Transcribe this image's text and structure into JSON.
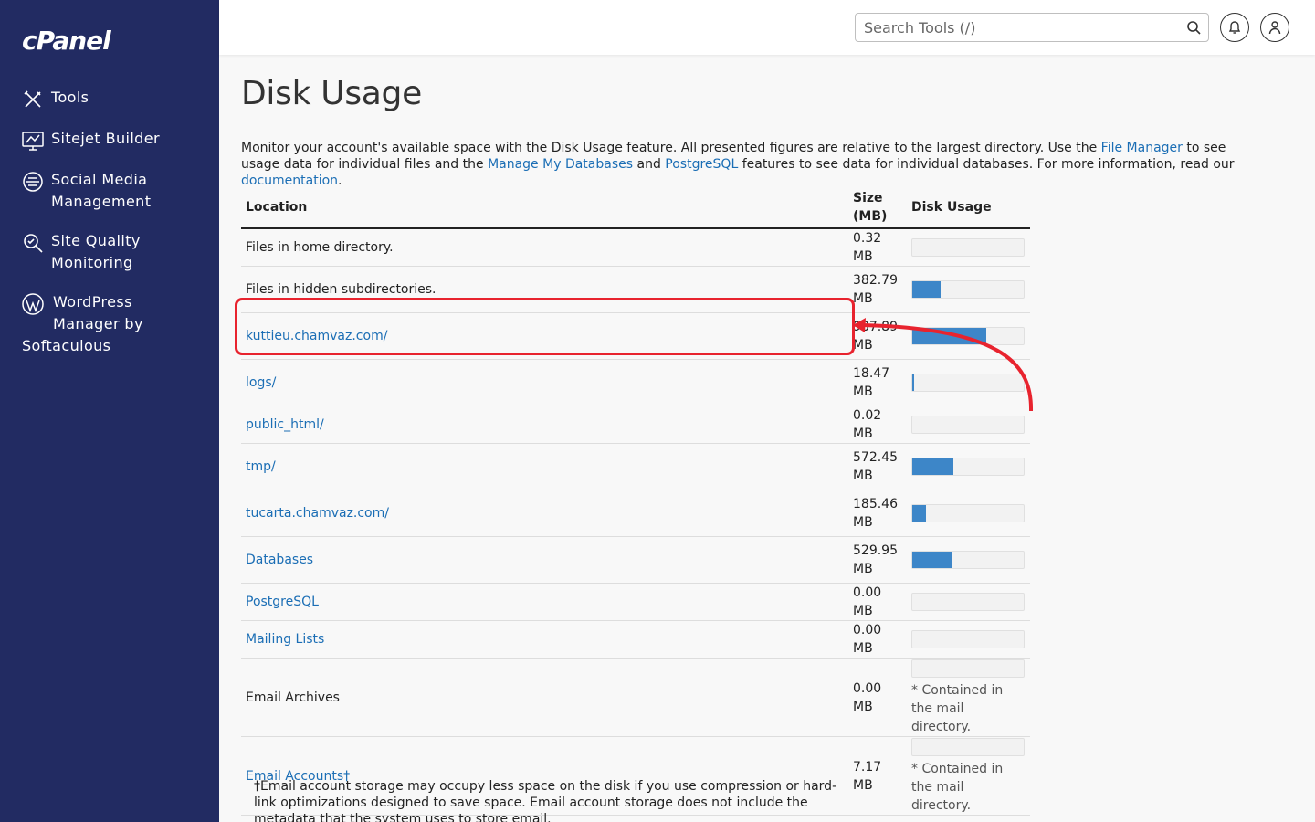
{
  "app": {
    "logo": "cPanel",
    "brand_color": "#222b62",
    "accent_color": "#1b6eb5"
  },
  "sidebar": {
    "items": [
      {
        "label": "Tools",
        "icon": "tools-icon"
      },
      {
        "label": "Sitejet Builder",
        "icon": "sitejet-icon"
      },
      {
        "label": "Social Media Management",
        "icon": "social-media-icon"
      },
      {
        "label": "Site Quality Monitoring",
        "icon": "site-quality-icon"
      },
      {
        "label_line1": "WordPress",
        "label_line2": "Manager by",
        "label_line3": "Softaculous",
        "icon": "wordpress-icon"
      }
    ]
  },
  "header": {
    "search_placeholder": "Search Tools (/)",
    "search_icon": "search-icon",
    "notifications_icon": "bell-icon",
    "user_icon": "user-icon"
  },
  "page": {
    "title": "Disk Usage",
    "intro": {
      "part1": "Monitor your account's available space with the Disk Usage feature. All presented figures are relative to the largest directory. Use the ",
      "link1": "File Manager",
      "part2": " to see usage data for individual files and the ",
      "link2": "Manage My Databases",
      "part3": " and ",
      "link3": "PostgreSQL",
      "part4": " features to see data for individual databases. For more information, read our ",
      "link4": "documentation",
      "part5": "."
    }
  },
  "table": {
    "headers": {
      "location": "Location",
      "size": "Size (MB)",
      "usage": "Disk Usage"
    },
    "rows": [
      {
        "location": "Files in home directory.",
        "size": "0.32 MB",
        "fraction": 0.0,
        "link": false
      },
      {
        "location": "Files in hidden subdirectories.",
        "size": "382.79 MB",
        "fraction": 0.25,
        "link": false
      },
      {
        "location": "kuttieu.chamvaz.com/",
        "size": "987.89 MB",
        "fraction": 0.66,
        "link": true
      },
      {
        "location": "logs/",
        "size": "18.47 MB",
        "fraction": 0.02,
        "link": true
      },
      {
        "location": "public_html/",
        "size": "0.02 MB",
        "fraction": 0.0,
        "link": true
      },
      {
        "location": "tmp/",
        "size": "572.45 MB",
        "fraction": 0.37,
        "link": true
      },
      {
        "location": "tucarta.chamvaz.com/",
        "size": "185.46 MB",
        "fraction": 0.12,
        "link": true
      },
      {
        "location": "Databases",
        "size": "529.95 MB",
        "fraction": 0.35,
        "link": true
      },
      {
        "location": "PostgreSQL",
        "size": "0.00 MB",
        "fraction": 0.0,
        "link": true
      },
      {
        "location": "Mailing Lists",
        "size": "0.00 MB",
        "fraction": 0.0,
        "link": true
      },
      {
        "location": "Email Archives",
        "size": "0.00 MB",
        "fraction": 0.0,
        "link": false,
        "note": "* Contained in the mail directory."
      },
      {
        "location": "Email Accounts†",
        "size": "7.17 MB",
        "fraction": 0.0,
        "link": true,
        "note": "* Contained in the mail directory."
      }
    ],
    "footnote": "†Email account storage may occupy less space on the disk if you use compression or hard-link optimizations designed to save space. Email account storage does not include the metadata that the system uses to store email."
  },
  "annotation": {
    "highlight_color": "#e8232e",
    "highlighted_row": "kuttieu.chamvaz.com/"
  }
}
